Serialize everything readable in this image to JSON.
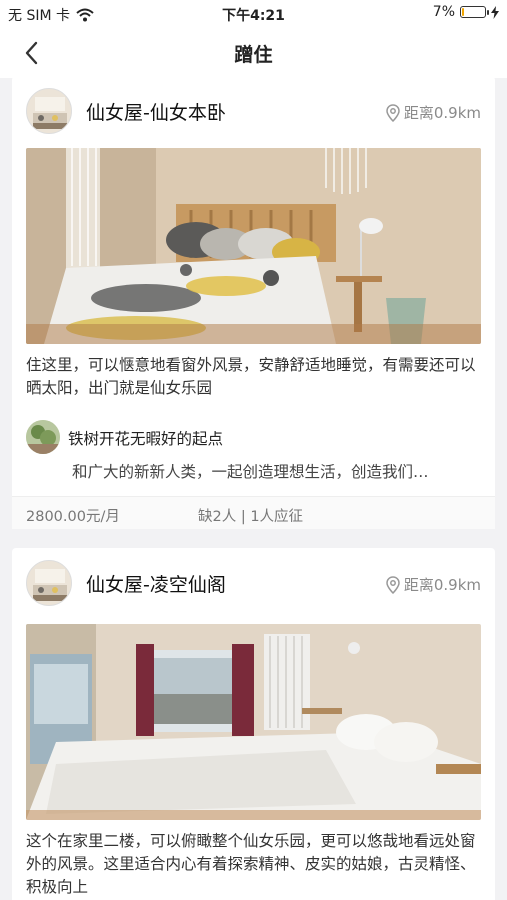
{
  "status_bar": {
    "carrier": "无 SIM 卡",
    "time": "下午4:21",
    "battery": "7%",
    "battery_level": 0.07
  },
  "nav": {
    "title": "蹭住"
  },
  "listings": [
    {
      "title": "仙女屋-仙女本卧",
      "distance": "距离0.9km",
      "description": "住这里，可以惬意地看窗外风景，安静舒适地睡觉，有需要还可以晒太阳，出门就是仙女乐园",
      "comment_author": "铁树开花无暇好的起点",
      "comment_text": "和广大的新新人类，一起创造理想生活，创造我们…",
      "price": "2800.00元/月",
      "slots": "缺2人 | 1人应征"
    },
    {
      "title": "仙女屋-凌空仙阁",
      "distance": "距离0.9km",
      "description": "这个在家里二楼，可以俯瞰整个仙女乐园，更可以悠哉地看远处窗外的风景。这里适合内心有着探索精神、皮实的姑娘，古灵精怪、积极向上"
    }
  ],
  "icons": {
    "back": "chevron-left-icon",
    "location": "location-pin-icon",
    "wifi": "wifi-icon",
    "charging": "bolt-icon"
  }
}
